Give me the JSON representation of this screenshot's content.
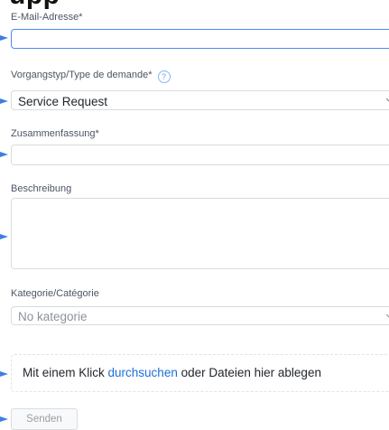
{
  "page": {
    "title": "upp"
  },
  "form": {
    "email": {
      "label": "E-Mail-Adresse*",
      "value": ""
    },
    "request_type": {
      "label": "Vorgangstyp/Type de demande*",
      "help": "?",
      "value": "Service Request"
    },
    "summary": {
      "label": "Zusammenfassung*",
      "value": ""
    },
    "description": {
      "label": "Beschreibung",
      "value": ""
    },
    "category": {
      "label": "Kategorie/Catégorie",
      "value": "No kategorie"
    },
    "attachment": {
      "prefix": "Mit einem Klick ",
      "link": "durchsuchen",
      "suffix": " oder Dateien hier ablegen"
    },
    "submit": {
      "label": "Senden"
    }
  },
  "colors": {
    "accent": "#4a8af4",
    "link": "#1a6fd8",
    "border": "#d7dbe0",
    "pointer": "#3d7fe0"
  }
}
